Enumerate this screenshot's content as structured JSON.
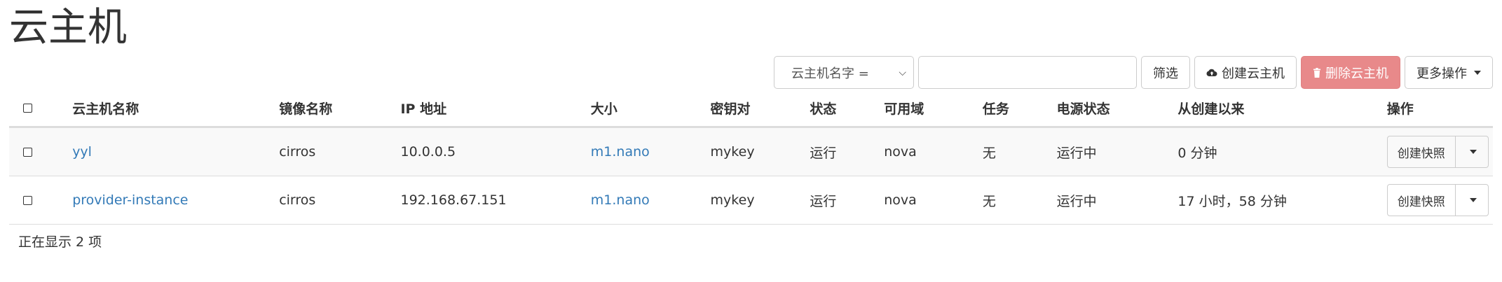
{
  "page": {
    "title": "云主机"
  },
  "toolbar": {
    "filter_select": "云主机名字 =",
    "filter_input_value": "",
    "filter_button": "筛选",
    "create_button": "创建云主机",
    "delete_button": "删除云主机",
    "more_button": "更多操作",
    "danger_color": "#e8898a"
  },
  "table": {
    "headers": [
      "云主机名称",
      "镜像名称",
      "IP 地址",
      "大小",
      "密钥对",
      "状态",
      "可用域",
      "任务",
      "电源状态",
      "从创建以来",
      "操作"
    ],
    "rows": [
      {
        "name": "yyl",
        "image": "cirros",
        "ip": "10.0.0.5",
        "size": "m1.nano",
        "keypair": "mykey",
        "status": "运行",
        "zone": "nova",
        "task": "无",
        "power": "运行中",
        "age": "0 分钟",
        "action": "创建快照"
      },
      {
        "name": "provider-instance",
        "image": "cirros",
        "ip": "192.168.67.151",
        "size": "m1.nano",
        "keypair": "mykey",
        "status": "运行",
        "zone": "nova",
        "task": "无",
        "power": "运行中",
        "age": "17 小时，58 分钟",
        "action": "创建快照"
      }
    ]
  },
  "footer": {
    "count_text": "正在显示 2 项"
  },
  "colors": {
    "link": "#337ab7"
  }
}
